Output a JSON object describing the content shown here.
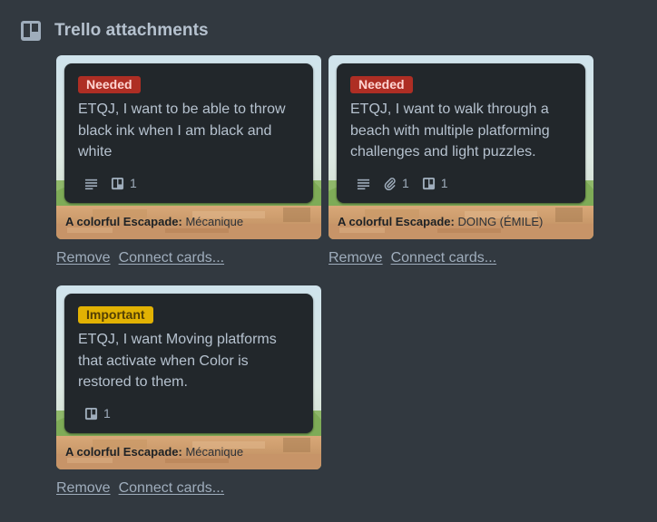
{
  "section": {
    "title": "Trello attachments",
    "icon": "trello-board-icon"
  },
  "attachments": [
    {
      "label": {
        "text": "Needed",
        "color": "#ae2e24"
      },
      "title": "ETQJ, I want to be able to throw black ink when I am black and white",
      "badges": [
        {
          "icon": "description-icon"
        },
        {
          "icon": "trello-card-icon",
          "count": "1"
        }
      ],
      "board": "A colorful Escapade:",
      "list": "Mécanique",
      "remove_label": "Remove",
      "connect_label": "Connect cards..."
    },
    {
      "label": {
        "text": "Needed",
        "color": "#ae2e24"
      },
      "title": "ETQJ, I want to walk through a beach with multiple platforming challenges and light puzzles.",
      "badges": [
        {
          "icon": "description-icon"
        },
        {
          "icon": "paperclip-icon",
          "count": "1"
        },
        {
          "icon": "trello-card-icon",
          "count": "1"
        }
      ],
      "board": "A colorful Escapade:",
      "list": "DOING (ÉMILE)",
      "remove_label": "Remove",
      "connect_label": "Connect cards..."
    },
    {
      "label": {
        "text": "Important",
        "color": "#e2b203"
      },
      "title": "ETQJ, I want Moving platforms that activate when Color is restored to them.",
      "badges": [
        {
          "icon": "trello-card-icon",
          "count": "1"
        }
      ],
      "board": "A colorful Escapade:",
      "list": "Mécanique",
      "remove_label": "Remove",
      "connect_label": "Connect cards..."
    }
  ]
}
